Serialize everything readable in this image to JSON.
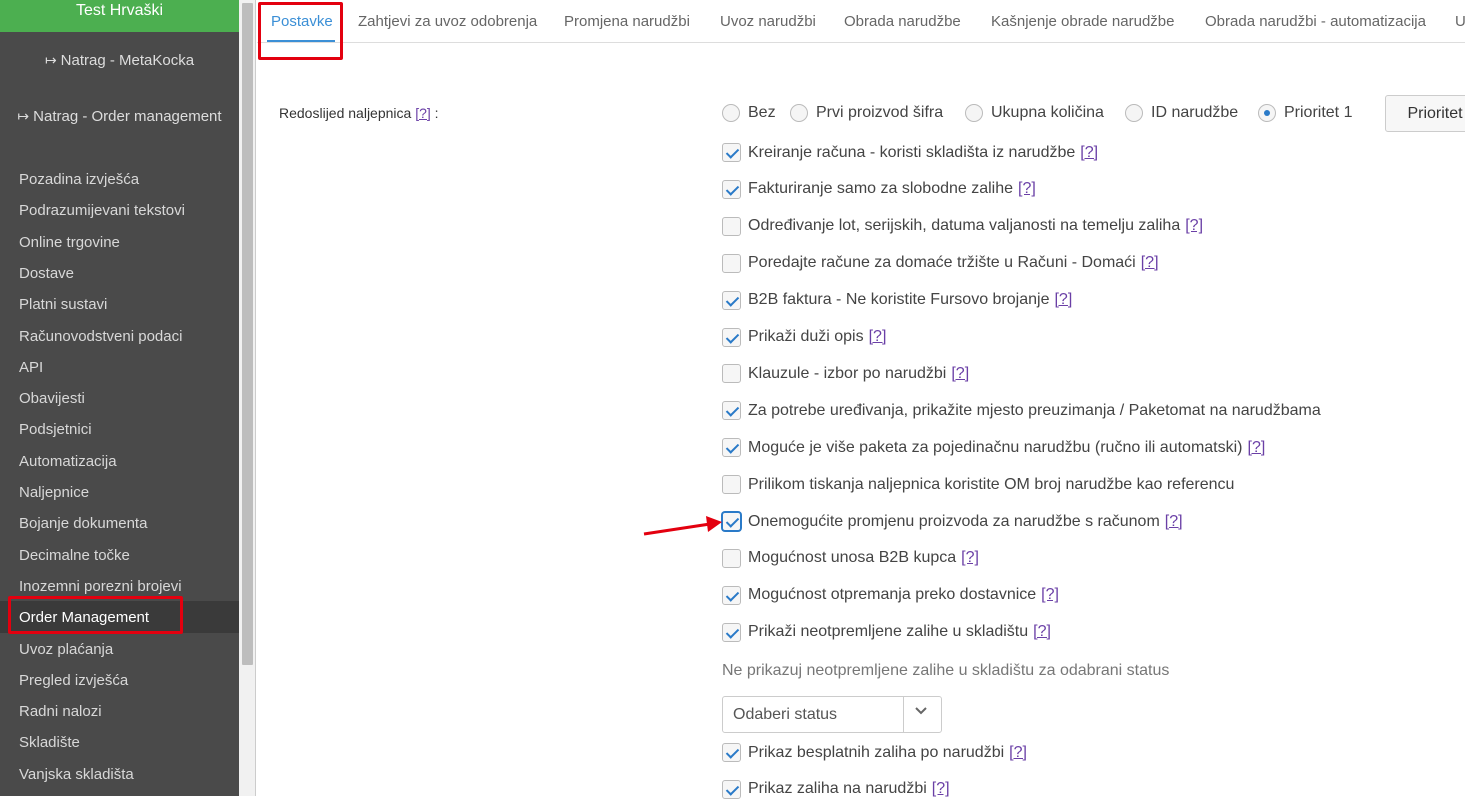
{
  "sidebar": {
    "header": "Test Hrvaški",
    "back_links": [
      "Natrag - MetaKocka",
      "Natrag - Order management"
    ],
    "items": [
      "Pozadina izvješća",
      "Podrazumijevani tekstovi",
      "Online trgovine",
      "Dostave",
      "Platni sustavi",
      "Računovodstveni podaci",
      "API",
      "Obavijesti",
      "Podsjetnici",
      "Automatizacija",
      "Naljepnice",
      "Bojanje dokumenta",
      "Decimalne točke",
      "Inozemni porezni brojevi",
      "Order Management",
      "Uvoz plaćanja",
      "Pregled izvješća",
      "Radni nalozi",
      "Skladište",
      "Vanjska skladišta"
    ],
    "active_item": "Order Management"
  },
  "tabs": [
    "Postavke",
    "Zahtjevi za uvoz odobrenja",
    "Promjena narudžbi",
    "Uvoz narudžbi",
    "Obrada narudžbe",
    "Kašnjenje obrade narudžbe",
    "Obrada narudžbi - automatizacija",
    "U"
  ],
  "active_tab": "Postavke",
  "form": {
    "sort_label": "Redoslijed naljepnica",
    "help": "[?]",
    "colon": ":",
    "radio_options": [
      {
        "label": "Bez",
        "checked": false
      },
      {
        "label": "Prvi proizvod šifra",
        "checked": false
      },
      {
        "label": "Ukupna količina",
        "checked": false
      },
      {
        "label": "ID narudžbe",
        "checked": false
      },
      {
        "label": "Prioritet 1",
        "checked": true
      }
    ],
    "prioritet_button": "Prioritet",
    "checkboxes": [
      {
        "label": "Kreiranje računa - koristi skladišta iz narudžbe",
        "checked": true,
        "help": true
      },
      {
        "label": "Fakturiranje samo za slobodne zalihe",
        "checked": true,
        "help": true
      },
      {
        "label": "Određivanje lot, serijskih, datuma valjanosti na temelju zaliha",
        "checked": false,
        "help": true
      },
      {
        "label": "Poredajte račune za domaće tržište u Računi - Domaći",
        "checked": false,
        "help": true
      },
      {
        "label": "B2B faktura - Ne koristite Fursovo brojanje",
        "checked": true,
        "help": true
      },
      {
        "label": "Prikaži duži opis",
        "checked": true,
        "help": true
      },
      {
        "label": "Klauzule - izbor po narudžbi",
        "checked": false,
        "help": true
      },
      {
        "label": "Za potrebe uređivanja, prikažite mjesto preuzimanja / Paketomat na narudžbama",
        "checked": true,
        "help": false
      },
      {
        "label": "Moguće je više paketa za pojedinačnu narudžbu (ručno ili automatski)",
        "checked": true,
        "help": true
      },
      {
        "label": "Prilikom tiskanja naljepnica koristite OM broj narudžbe kao referencu",
        "checked": false,
        "help": false
      },
      {
        "label": "Onemogućite promjenu proizvoda za narudžbe s računom",
        "checked": true,
        "help": true
      },
      {
        "label": "Mogućnost unosa B2B kupca",
        "checked": false,
        "help": true
      },
      {
        "label": "Mogućnost otpremanja preko dostavnice",
        "checked": true,
        "help": true
      },
      {
        "label": "Prikaži neotpremljene zalihe u skladištu",
        "checked": true,
        "help": true
      }
    ],
    "status_label": "Ne prikazuj neotpremljene zalihe u skladištu za odabrani status",
    "status_select": "Odaberi status",
    "checkboxes_bottom": [
      {
        "label": "Prikaz besplatnih zaliha po narudžbi",
        "checked": true,
        "help": true
      },
      {
        "label": "Prikaz zaliha na narudžbi",
        "checked": true,
        "help": true
      }
    ]
  },
  "colors": {
    "accent": "#3b8fd6",
    "sidebar_bg": "#4a4a4a",
    "header_green": "#4caf50",
    "highlight": "#e3000f",
    "help": "#6a3fa6"
  }
}
